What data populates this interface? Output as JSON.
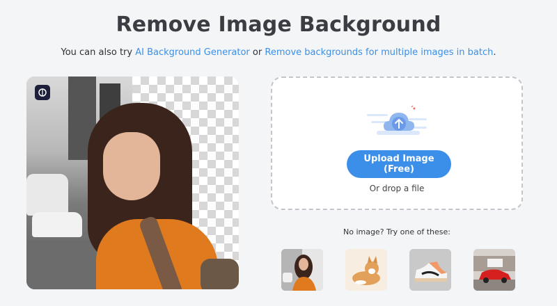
{
  "header": {
    "title": "Remove Image Background",
    "subtitle_prefix": "You can also try ",
    "link_ai": "AI Background Generator",
    "subtitle_mid": " or ",
    "link_batch": "Remove backgrounds for multiple images in batch",
    "subtitle_suffix": "."
  },
  "upload": {
    "button_label": "Upload Image (Free)",
    "drop_text": "Or drop a file"
  },
  "samples": {
    "prompt": "No image? Try one of these:",
    "items": [
      {
        "icon": "woman-photo"
      },
      {
        "icon": "dog-photo"
      },
      {
        "icon": "sneaker-photo"
      },
      {
        "icon": "red-car-photo"
      }
    ]
  },
  "colors": {
    "accent": "#3b8fe8",
    "title": "#3b3d42",
    "background": "#f4f5f7"
  }
}
